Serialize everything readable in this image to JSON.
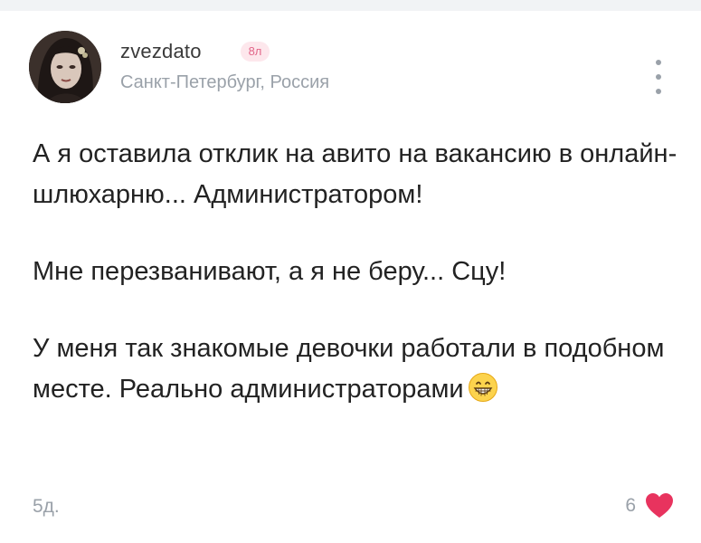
{
  "post": {
    "author": {
      "username": "zvezdato",
      "age_badge": "8л",
      "location": "Санкт-Петербург, Россия",
      "avatar_icon": "avatar-photo"
    },
    "paragraphs": [
      "А я оставила отклик на авито на вакансию в онлайн-шлюхарню... Администратором!",
      "Мне перезванивают, а я не беру... Сцу!",
      "У меня так знакомые девочки работали в подобном месте. Реально администраторами"
    ],
    "emoji": "grinning-face-emoji",
    "timestamp": "5д.",
    "likes": "6"
  },
  "colors": {
    "like_heart": "#e8335e",
    "badge_bg": "#fde7ec",
    "badge_text": "#e2678a",
    "muted_text": "#9aa1a9"
  }
}
